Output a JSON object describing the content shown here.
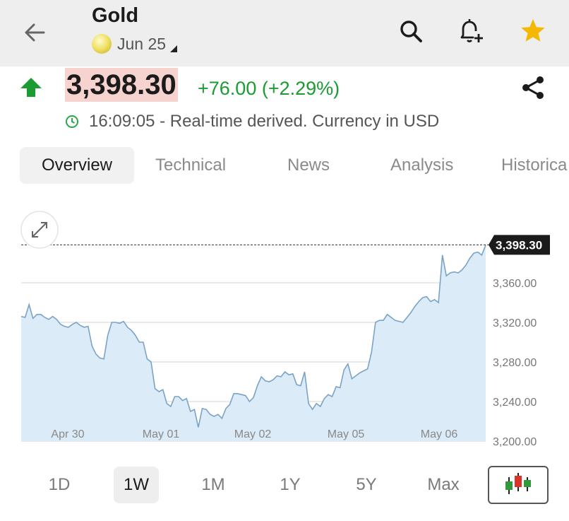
{
  "header": {
    "title": "Gold",
    "contract": "Jun 25",
    "icons": [
      "back-arrow-icon",
      "gold-coin-icon",
      "search-icon",
      "bell-add-icon",
      "star-icon"
    ],
    "star_color": "#f5b800"
  },
  "quote": {
    "price": "3,398.30",
    "change": "+76.00 (+2.29%)",
    "status": "16:09:05 - Real-time derived. Currency in USD",
    "direction": "up",
    "up_color": "#1a9c32",
    "price_bg": "#f7d3d0"
  },
  "tabs": [
    {
      "label": "Overview",
      "active": true
    },
    {
      "label": "Technical",
      "active": false
    },
    {
      "label": "News",
      "active": false
    },
    {
      "label": "Analysis",
      "active": false
    },
    {
      "label": "Historica",
      "active": false
    }
  ],
  "chart_data": {
    "type": "area",
    "title": "",
    "xlabel": "",
    "ylabel": "",
    "x_ticks": [
      "Apr 30",
      "May 01",
      "May 02",
      "May 05",
      "May 06"
    ],
    "y_ticks": [
      "3,360.00",
      "3,320.00",
      "3,280.00",
      "3,240.00",
      "3,200.00"
    ],
    "ylim": [
      3200,
      3400
    ],
    "last_price_label": "3,398.30",
    "last_price": 3398.3,
    "line_color": "#7aa3c7",
    "fill_color": "#dcebf8",
    "series": [
      {
        "values": [
          3326,
          3325,
          3338,
          3324,
          3328,
          3328,
          3325,
          3323,
          3326,
          3323,
          3318,
          3316,
          3315,
          3318,
          3320,
          3317,
          3315,
          3316,
          3296,
          3288,
          3284,
          3283,
          3307,
          3320,
          3320,
          3319,
          3321,
          3315,
          3312,
          3307,
          3300,
          3300,
          3283,
          3280,
          3253,
          3250,
          3252,
          3238,
          3235,
          3245,
          3245,
          3241,
          3243,
          3230,
          3232,
          3214,
          3233,
          3232,
          3227,
          3225,
          3227,
          3223,
          3233,
          3237,
          3248,
          3248,
          3247,
          3246,
          3240,
          3244,
          3256,
          3265,
          3261,
          3260,
          3262,
          3266,
          3265,
          3270,
          3267,
          3268,
          3257,
          3256,
          3270,
          3238,
          3232,
          3238,
          3235,
          3243,
          3247,
          3245,
          3255,
          3254,
          3272,
          3278,
          3263,
          3266,
          3269,
          3271,
          3273,
          3290,
          3320,
          3322,
          3322,
          3328,
          3325,
          3322,
          3321,
          3320,
          3325,
          3330,
          3336,
          3341,
          3345,
          3346,
          3341,
          3343,
          3340,
          3388,
          3367,
          3370,
          3371,
          3370,
          3373,
          3378,
          3385,
          3390,
          3391,
          3388,
          3398
        ]
      }
    ],
    "grid": true,
    "legend": "none"
  },
  "ranges": [
    {
      "label": "1D",
      "active": false
    },
    {
      "label": "1W",
      "active": true
    },
    {
      "label": "1M",
      "active": false
    },
    {
      "label": "1Y",
      "active": false
    },
    {
      "label": "5Y",
      "active": false
    },
    {
      "label": "Max",
      "active": false
    }
  ],
  "chart_type_button": {
    "icon": "candlestick-icon"
  }
}
